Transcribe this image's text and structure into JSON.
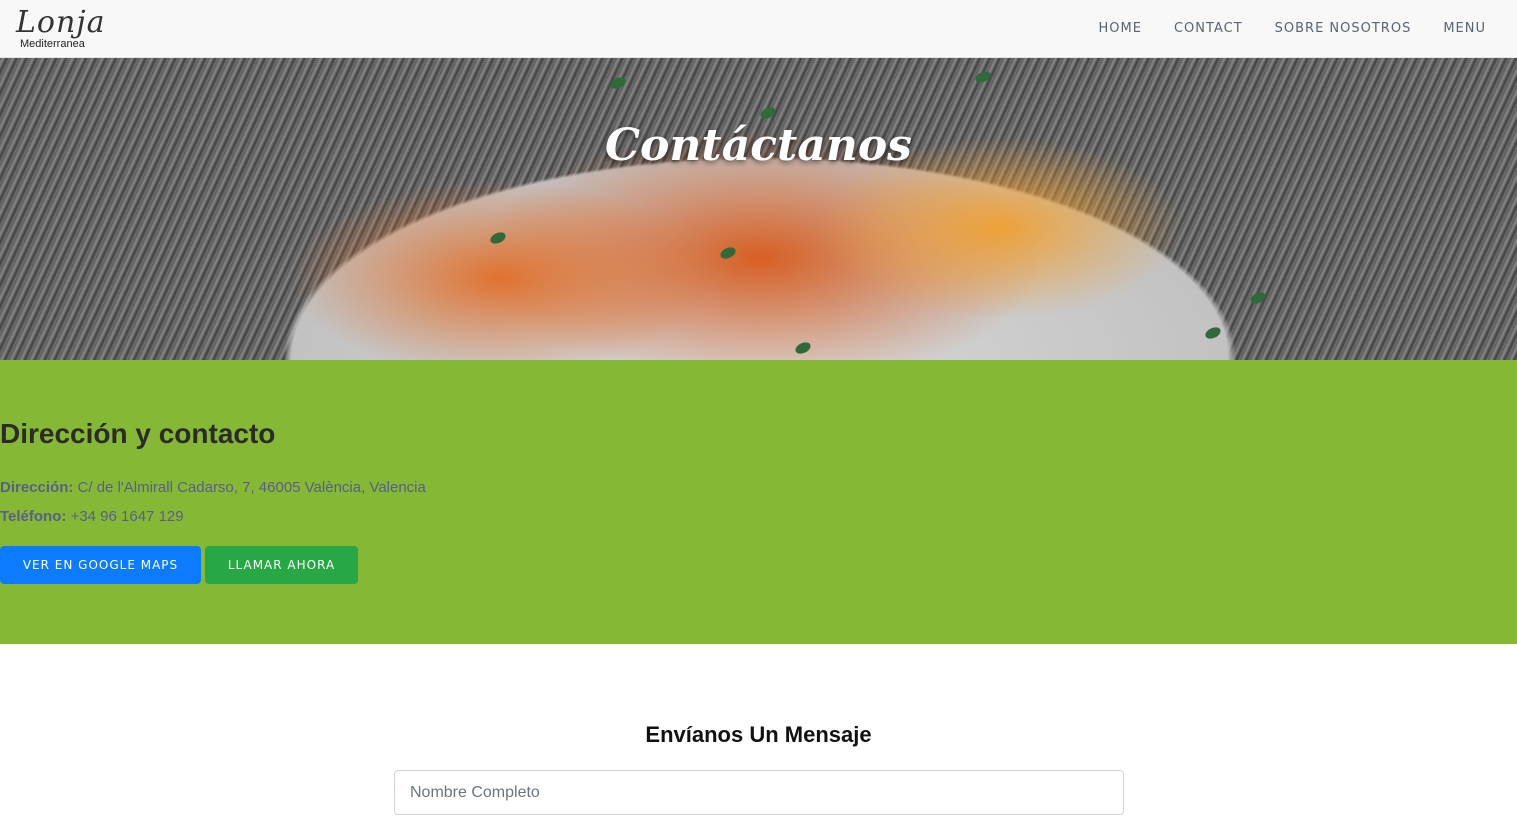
{
  "navbar": {
    "logo_script": "Lonja",
    "logo_sub": "Mediterranea",
    "links": [
      "HOME",
      "CONTACT",
      "SOBRE NOSOTROS",
      "MENU"
    ]
  },
  "hero": {
    "title": "Contáctanos"
  },
  "contact": {
    "heading": "Dirección y contacto",
    "address_label": "Dirección:",
    "address_value": "C/ de l'Almirall Cadarso, 7, 46005 València, Valencia",
    "phone_label": "Teléfono:",
    "phone_value": "+34 96 1647 129",
    "maps_button": "VER EN GOOGLE MAPS",
    "call_button": "LLAMAR AHORA"
  },
  "message": {
    "title": "Envíanos Un Mensaje",
    "name_placeholder": "Nombre Completo"
  },
  "colors": {
    "section_green": "#85b834",
    "button_blue": "#0d7bff",
    "button_green": "#28a745"
  }
}
